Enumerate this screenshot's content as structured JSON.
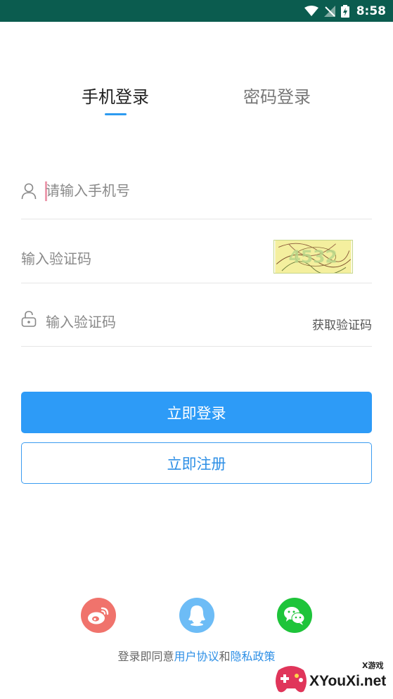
{
  "status_bar": {
    "time": "8:58",
    "background": "#0b5c4f"
  },
  "tabs": [
    {
      "label": "手机登录",
      "active": true
    },
    {
      "label": "密码登录",
      "active": false
    }
  ],
  "form": {
    "phone_placeholder": "请输入手机号",
    "captcha_placeholder": "输入验证码",
    "sms_placeholder": "输入验证码",
    "get_code_label": "获取验证码",
    "captcha_text": "4532"
  },
  "buttons": {
    "login_label": "立即登录",
    "register_label": "立即注册"
  },
  "social": [
    {
      "icon": "weibo-icon",
      "color": "#f0736c"
    },
    {
      "icon": "qq-icon",
      "color": "#6dbcf6"
    },
    {
      "icon": "wechat-icon",
      "color": "#1ec43a"
    }
  ],
  "agreement": {
    "prefix": "登录即同意",
    "user_agreement": "用户协议",
    "and": "和",
    "privacy_policy": "隐私政策"
  },
  "watermark": {
    "main": "XYouXi.net",
    "small": "X游戏"
  },
  "colors": {
    "accent": "#2d9bf7",
    "register_text": "#2d8fe6"
  }
}
